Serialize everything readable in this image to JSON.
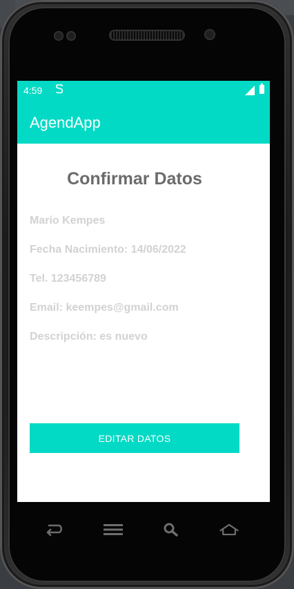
{
  "status_bar": {
    "time": "4:59",
    "app_icon": "notification-app-icon",
    "signal_icon": "signal-icon",
    "battery_icon": "battery-icon"
  },
  "app_bar": {
    "title": "AgendApp"
  },
  "main": {
    "title": "Confirmar Datos",
    "fields": {
      "name": "Mario Kempes",
      "birth_date": "Fecha Nacimiento: 14/06/2022",
      "phone": "Tel. 123456789",
      "email": "Email: keempes@gmail.com",
      "description": "Descripción: es nuevo"
    },
    "edit_button_label": "EDITAR DATOS"
  },
  "nav_bar": {
    "icons": [
      "back-icon",
      "menu-icon",
      "search-icon",
      "home-icon"
    ]
  },
  "colors": {
    "accent": "#03dac5",
    "title_text": "#6b6b6b",
    "field_text": "#d2d2d2"
  }
}
